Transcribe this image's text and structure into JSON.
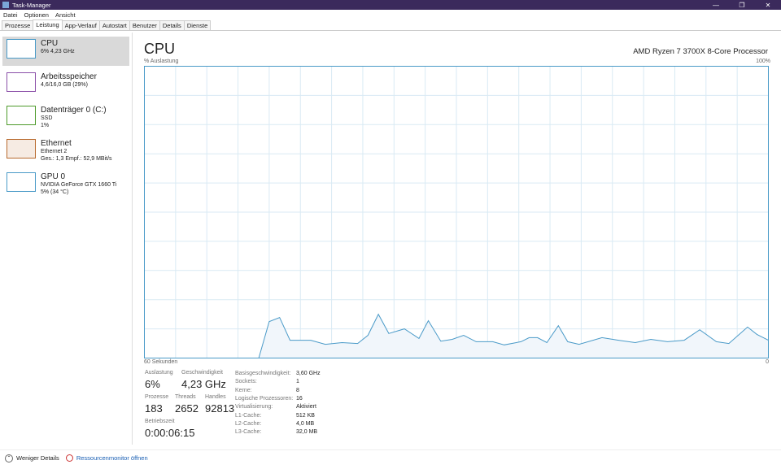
{
  "window": {
    "title": "Task-Manager"
  },
  "menu": [
    "Datei",
    "Optionen",
    "Ansicht"
  ],
  "tabs": [
    "Prozesse",
    "Leistung",
    "App-Verlauf",
    "Autostart",
    "Benutzer",
    "Details",
    "Dienste"
  ],
  "sidebar": {
    "items": [
      {
        "name": "CPU",
        "line1": "6% 4,23 GHz",
        "line2": "",
        "color": "#4a9ac8"
      },
      {
        "name": "Arbeitsspeicher",
        "line1": "4,6/16,0 GB (29%)",
        "line2": "",
        "color": "#8b4fa8"
      },
      {
        "name": "Datenträger 0 (C:)",
        "line1": "SSD",
        "line2": "1%",
        "color": "#4d9a2a"
      },
      {
        "name": "Ethernet",
        "line1": "Ethernet 2",
        "line2": "Ges.: 1,3 Empf.: 52,9 MBit/s",
        "color": "#b86a2e"
      },
      {
        "name": "GPU 0",
        "line1": "NVIDIA GeForce GTX 1660 Ti",
        "line2": "5% (34 °C)",
        "color": "#4a9ac8"
      }
    ]
  },
  "main": {
    "title": "CPU",
    "processor": "AMD Ryzen 7 3700X 8-Core Processor",
    "ylabel": "% Auslastung",
    "ymax_label": "100%",
    "xlabel_left": "60 Sekunden",
    "xlabel_right": "0"
  },
  "chart_data": {
    "type": "area",
    "xlabel": "60 Sekunden",
    "ylabel": "% Auslastung",
    "xlim": [
      60,
      0
    ],
    "ylim": [
      0,
      100
    ],
    "grid": true,
    "color": "#4a9ac8",
    "x": [
      60,
      49,
      48,
      47,
      46,
      44,
      42.6,
      41,
      39.5,
      38.5,
      37.5,
      36.5,
      35,
      33.6,
      32.7,
      31.5,
      30.4,
      29.3,
      28.1,
      26.5,
      25.4,
      23.8,
      23,
      22.2,
      21.3,
      20.2,
      19.3,
      18.2,
      16,
      14.4,
      12.8,
      11.3,
      9.7,
      8.1,
      6.6,
      5,
      3.8,
      2,
      1.1,
      0
    ],
    "y": [
      0,
      0,
      12.5,
      13.9,
      6.1,
      6.1,
      4.7,
      5.3,
      5,
      7.8,
      15,
      8.4,
      10,
      6.7,
      12.8,
      5.8,
      6.4,
      7.8,
      5.6,
      5.6,
      4.5,
      5.6,
      7,
      7,
      5.3,
      11.1,
      5.6,
      4.7,
      7,
      6.1,
      5.3,
      6.4,
      5.6,
      6.1,
      9.7,
      5.6,
      5,
      10.6,
      8.1,
      6.1
    ]
  },
  "stats": {
    "auslastung_label": "Auslastung",
    "auslastung": "6%",
    "speed_label": "Geschwindigkeit",
    "speed": "4,23 GHz",
    "prozesse_label": "Prozesse",
    "prozesse": "183",
    "threads_label": "Threads",
    "threads": "2652",
    "handles_label": "Handles",
    "handles": "92813",
    "uptime_label": "Betriebszeit",
    "uptime": "0:00:06:15"
  },
  "specs": [
    [
      "Basisgeschwindigkeit:",
      "3,60 GHz"
    ],
    [
      "Sockets:",
      "1"
    ],
    [
      "Kerne:",
      "8"
    ],
    [
      "Logische Prozessoren:",
      "16"
    ],
    [
      "Virtualisierung:",
      "Aktiviert"
    ],
    [
      "L1-Cache:",
      "512 KB"
    ],
    [
      "L2-Cache:",
      "4,0 MB"
    ],
    [
      "L3-Cache:",
      "32,0 MB"
    ]
  ],
  "footer": {
    "less": "Weniger Details",
    "resmon": "Ressourcenmonitor öffnen"
  }
}
